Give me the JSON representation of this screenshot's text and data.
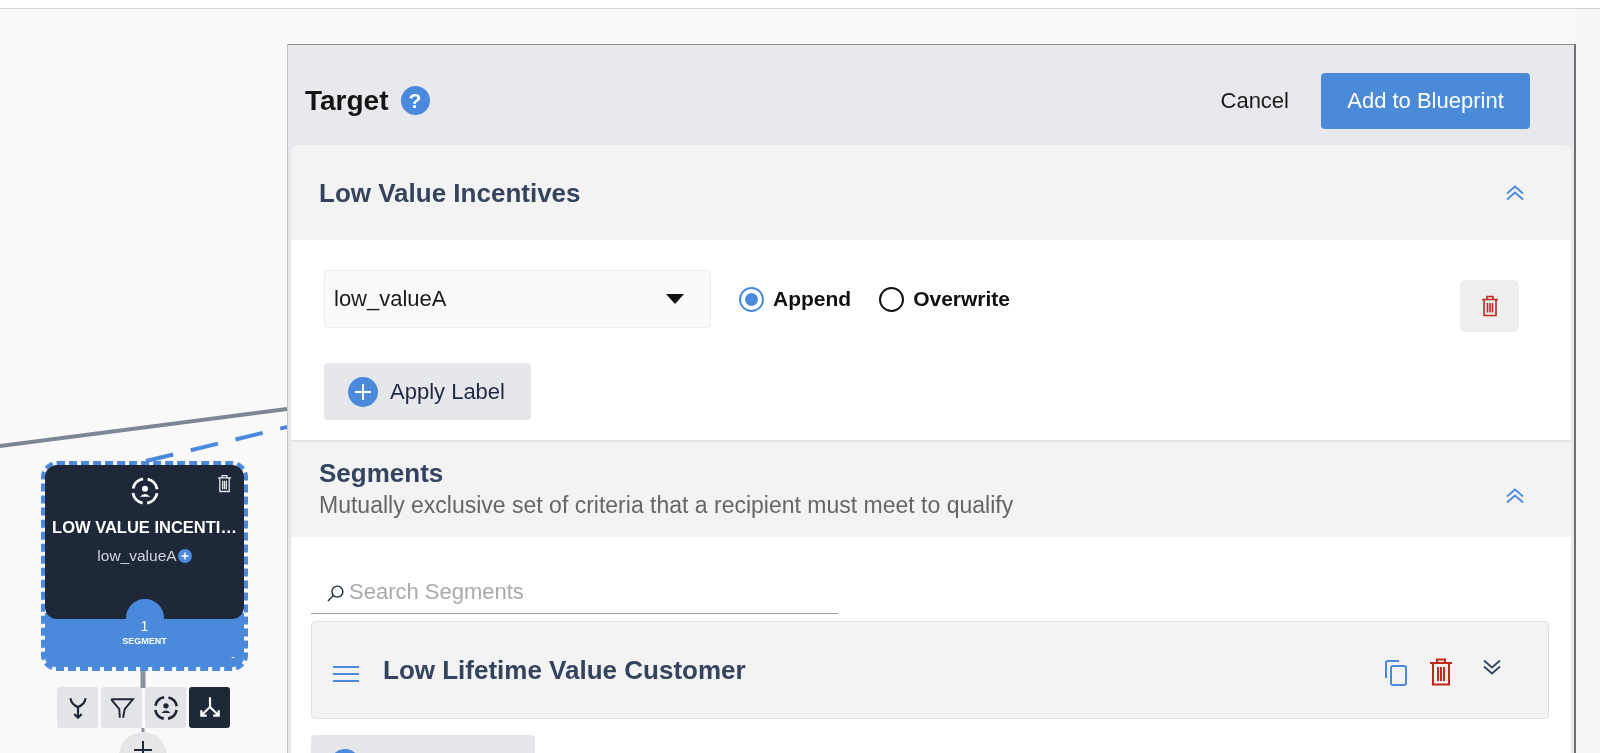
{
  "canvas": {
    "node": {
      "title": "LOW VALUE INCENTI…",
      "label": "low_valueA",
      "count": "1",
      "count_caption": "SEGMENT",
      "corner_mark": "-",
      "selected": true
    },
    "node_tools": [
      {
        "kind": "merge",
        "selected": false
      },
      {
        "kind": "filter",
        "selected": false
      },
      {
        "kind": "target",
        "selected": false
      },
      {
        "kind": "split",
        "selected": true
      }
    ]
  },
  "panel": {
    "title": "Target",
    "help": "?",
    "cancel": "Cancel",
    "submit": "Add to Blueprint"
  },
  "label_section": {
    "title": "Low Value Incentives",
    "expanded": true,
    "labels": [
      {
        "value": "low_valueA",
        "modes": [
          {
            "label": "Append",
            "selected": true
          },
          {
            "label": "Overwrite",
            "selected": false
          }
        ]
      }
    ],
    "apply_button": "Apply Label"
  },
  "segments_section": {
    "title": "Segments",
    "subtitle": "Mutually exclusive set of criteria that a recipient must meet to qualify",
    "expanded": true,
    "search": {
      "placeholder": "Search Segments"
    },
    "segments": [
      {
        "name": "Low Lifetime Value Customer",
        "expanded": false
      }
    ]
  }
}
